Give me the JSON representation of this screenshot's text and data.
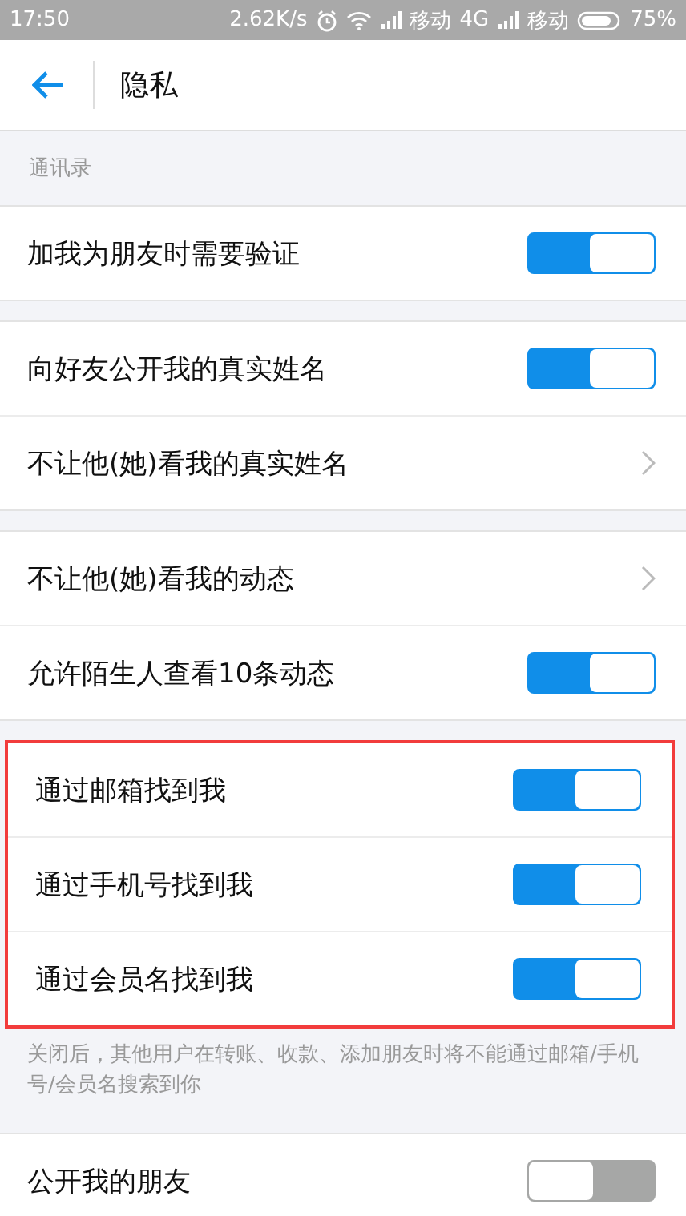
{
  "status_bar": {
    "time": "17:50",
    "speed": "2.62K/s",
    "carrier_1": "移动",
    "network": "4G",
    "carrier_2": "移动",
    "battery": "75%"
  },
  "header": {
    "title": "隐私"
  },
  "groups": [
    {
      "label": "通讯录",
      "highlighted": false,
      "rows": [
        {
          "kind": "toggle",
          "label": "加我为朋友时需要验证",
          "on": true
        }
      ]
    },
    {
      "highlighted": false,
      "rows": [
        {
          "kind": "toggle",
          "label": "向好友公开我的真实姓名",
          "on": true
        },
        {
          "kind": "link",
          "label": "不让他(她)看我的真实姓名"
        }
      ]
    },
    {
      "highlighted": false,
      "rows": [
        {
          "kind": "link",
          "label": "不让他(她)看我的动态"
        },
        {
          "kind": "toggle",
          "label": "允许陌生人查看10条动态",
          "on": true
        }
      ]
    },
    {
      "highlighted": true,
      "rows": [
        {
          "kind": "toggle",
          "label": "通过邮箱找到我",
          "on": true
        },
        {
          "kind": "toggle",
          "label": "通过手机号找到我",
          "on": true
        },
        {
          "kind": "toggle",
          "label": "通过会员名找到我",
          "on": true
        }
      ],
      "note": "关闭后，其他用户在转账、收款、添加朋友时将不能通过邮箱/手机号/会员名搜索到你"
    },
    {
      "highlighted": false,
      "rows": [
        {
          "kind": "toggle",
          "label": "公开我的朋友",
          "on": false
        }
      ]
    }
  ]
}
